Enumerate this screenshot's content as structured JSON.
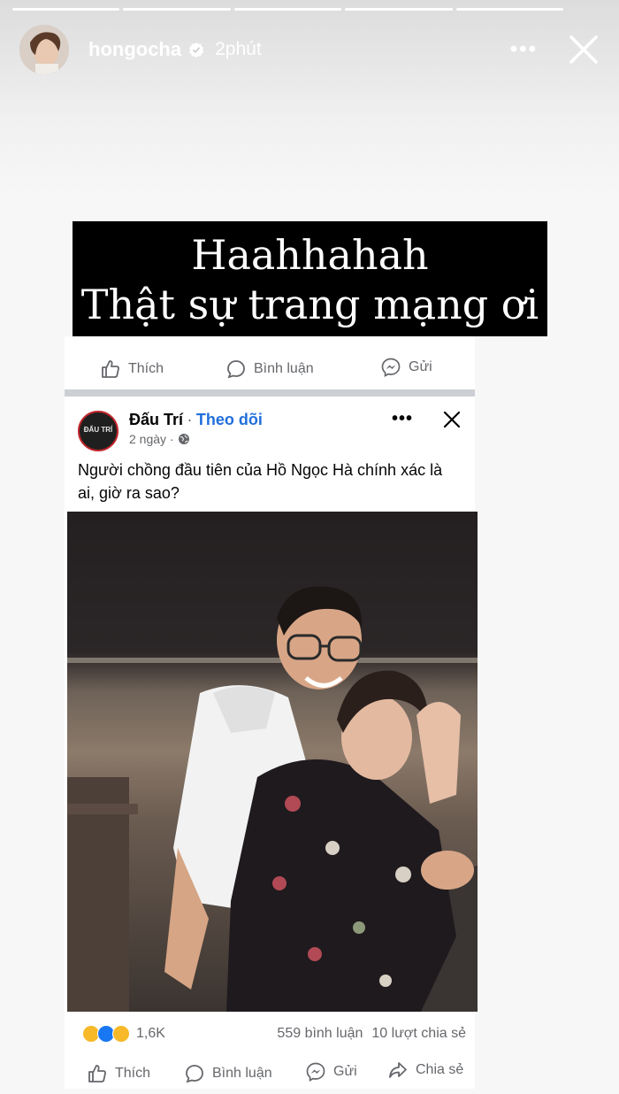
{
  "story": {
    "username": "hongocha",
    "time": "2phút",
    "progress_segments": 5,
    "caption": {
      "line1": "Haahhahah",
      "line2": "Thật sự trang mạng ơi"
    }
  },
  "top_card": {
    "actions": [
      "Thích",
      "Bình luận",
      "Gửi"
    ]
  },
  "post": {
    "page_name": "Đấu Trí",
    "avatar_text": "ĐẤU TRÍ",
    "separator": "·",
    "follow": "Theo dõi",
    "age": "2 ngày ·",
    "text": "Người chồng đầu tiên của Hồ Ngọc Hà chính xác là ai, giờ ra sao?",
    "reactions_count": "1,6K",
    "comments": "559 bình luận",
    "shares": "10 lượt chia sẻ",
    "actions": [
      "Thích",
      "Bình luận",
      "Gửi",
      "Chia sẻ"
    ]
  },
  "colors": {
    "accent": "#216fdb",
    "caption_bg": "#000000",
    "secondary_text": "#65676b"
  }
}
